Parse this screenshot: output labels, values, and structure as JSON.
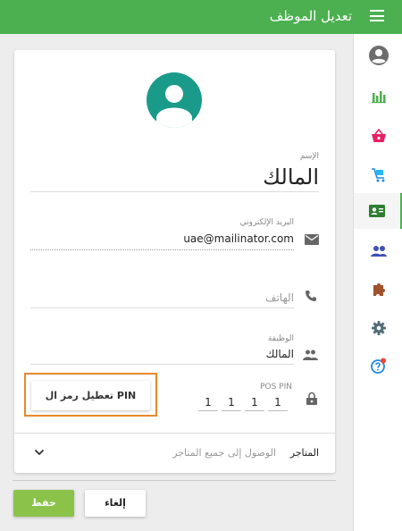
{
  "header": {
    "title": "تعديل الموظف",
    "color": "#4caf50"
  },
  "rail": {
    "items": [
      {
        "icon": "account-circle-icon"
      },
      {
        "icon": "bar-chart-icon"
      },
      {
        "icon": "basket-icon"
      },
      {
        "icon": "cart-icon"
      },
      {
        "icon": "employee-card-icon",
        "active": true
      },
      {
        "icon": "people-icon"
      },
      {
        "icon": "puzzle-icon"
      },
      {
        "icon": "gear-icon"
      },
      {
        "icon": "help-icon"
      }
    ]
  },
  "form": {
    "name": {
      "label": "الإسم",
      "value": "المالك"
    },
    "email": {
      "label": "البريد الإلكتروني",
      "value": "uae@mailinator.com"
    },
    "phone": {
      "placeholder": "الهاتف"
    },
    "role": {
      "label": "الوظيفة",
      "value": "المالك"
    },
    "pin": {
      "label": "POS PIN",
      "digits": [
        "1",
        "1",
        "1",
        "1"
      ]
    },
    "disable_pin_button": "تعطيل رمز ال PIN",
    "stores": {
      "label": "المتاجر",
      "value": "الوصول إلى جميع المتاجر"
    }
  },
  "actions": {
    "cancel": "إلغاء",
    "save": "حفظ"
  },
  "colors": {
    "accent": "#4caf50",
    "save_button": "#8bc34a",
    "avatar": "#1a9b8a",
    "highlight": "#e8882c"
  }
}
